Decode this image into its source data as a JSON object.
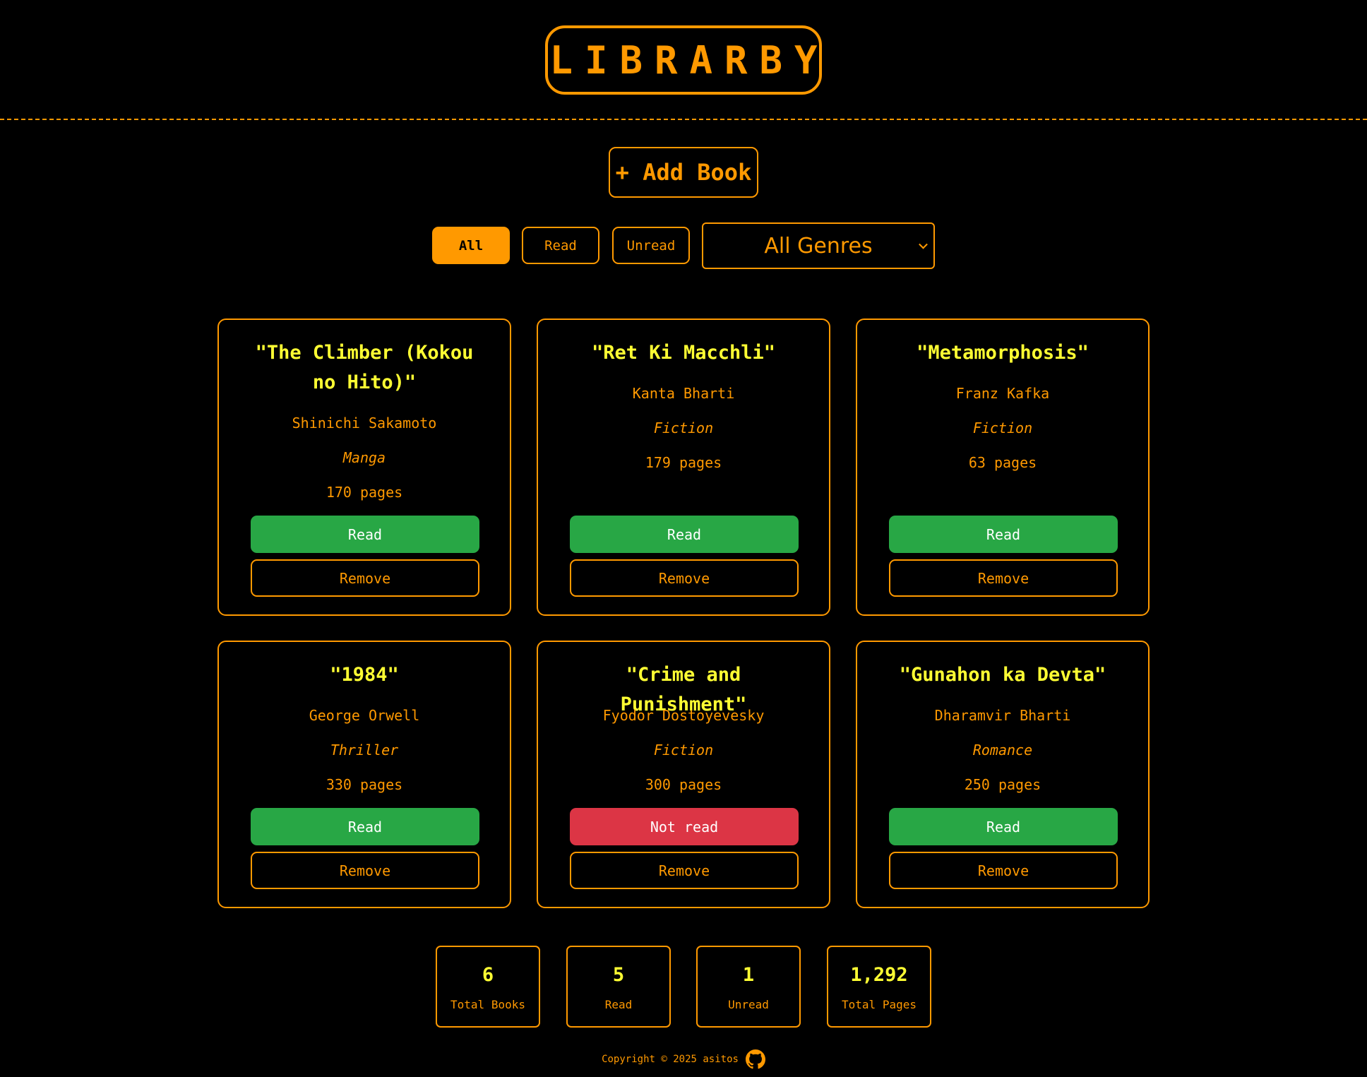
{
  "header": {
    "logo": "LIBRARBY"
  },
  "toolbar": {
    "add_book_label": "+ Add Book",
    "filters": [
      "All",
      "Read",
      "Unread"
    ],
    "active_filter": "All",
    "genre_select_value": "All Genres"
  },
  "books": [
    {
      "title": "\"The Climber (Kokou no Hito)\"",
      "author": "Shinichi Sakamoto",
      "genre": "Manga",
      "pages": "170 pages",
      "status": "Read",
      "remove": "Remove"
    },
    {
      "title": "\"Ret Ki Macchli\"",
      "author": "Kanta Bharti",
      "genre": "Fiction",
      "pages": "179 pages",
      "status": "Read",
      "remove": "Remove"
    },
    {
      "title": "\"Metamorphosis\"",
      "author": "Franz Kafka",
      "genre": "Fiction",
      "pages": "63 pages",
      "status": "Read",
      "remove": "Remove"
    },
    {
      "title": "\"1984\"",
      "author": "George Orwell",
      "genre": "Thriller",
      "pages": "330 pages",
      "status": "Read",
      "remove": "Remove"
    },
    {
      "title": "\"Crime and Punishment\"",
      "author": "Fyodor Dostoyevesky",
      "genre": "Fiction",
      "pages": "300 pages",
      "status": "Not read",
      "remove": "Remove"
    },
    {
      "title": "\"Gunahon ka Devta\"",
      "author": "Dharamvir Bharti",
      "genre": "Romance",
      "pages": "250 pages",
      "status": "Read",
      "remove": "Remove"
    }
  ],
  "stats": [
    {
      "value": "6",
      "label": "Total Books"
    },
    {
      "value": "5",
      "label": "Read"
    },
    {
      "value": "1",
      "label": "Unread"
    },
    {
      "value": "1,292",
      "label": "Total Pages"
    }
  ],
  "footer": {
    "copyright": "Copyright © 2025 asitos",
    "icon": "github-icon"
  },
  "colors": {
    "accent": "#ff9900",
    "title": "#ffff33",
    "read": "#28a745",
    "not_read": "#dc3545",
    "background": "#000000"
  }
}
